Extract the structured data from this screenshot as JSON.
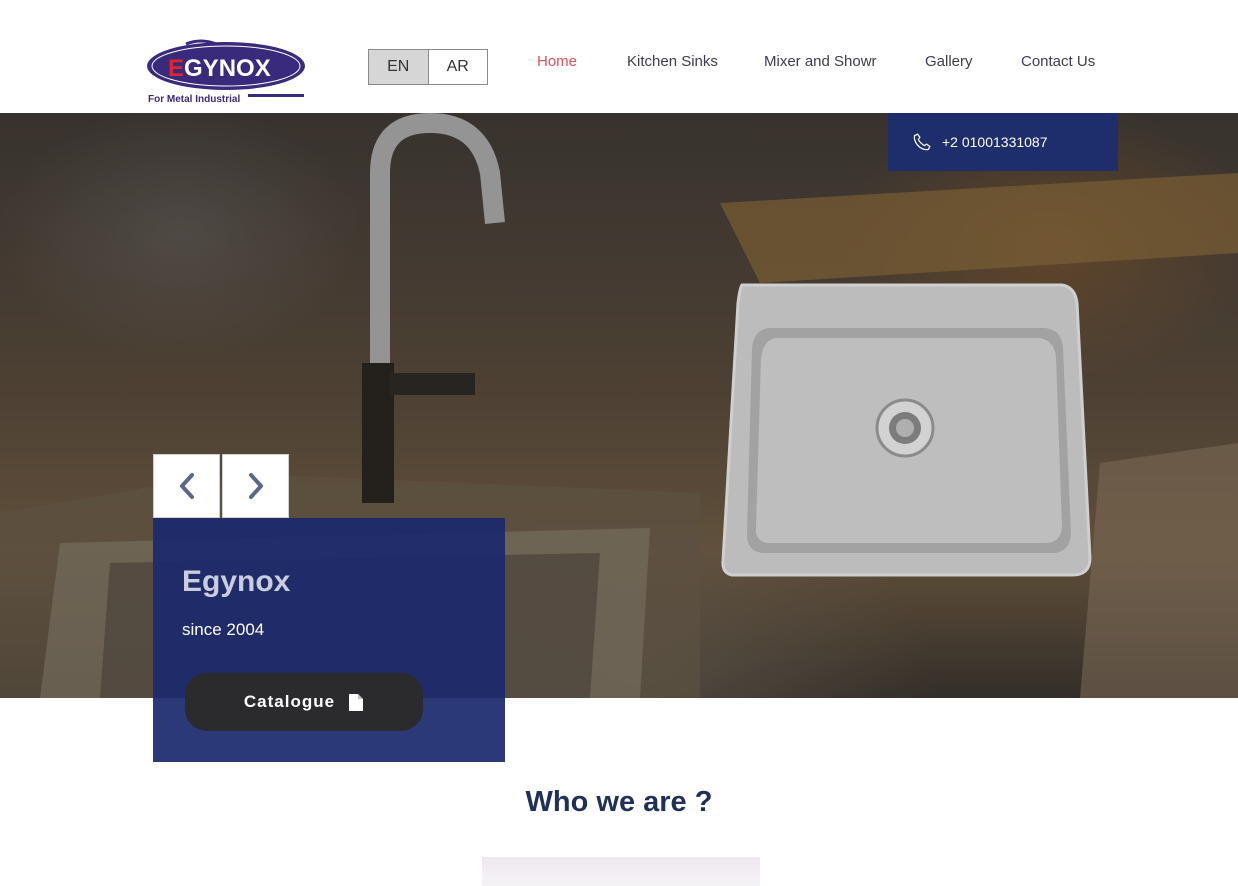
{
  "header": {
    "logo": {
      "brand": "EGYNOX",
      "tagline": "For Metal Industrial"
    },
    "language": {
      "options": [
        "EN",
        "AR"
      ],
      "selected": "EN"
    },
    "nav": [
      {
        "label": "Home",
        "active": true
      },
      {
        "label": "Kitchen Sinks",
        "active": false
      },
      {
        "label": "Mixer and Showr",
        "active": false
      },
      {
        "label": "Gallery",
        "active": false
      },
      {
        "label": "Contact Us",
        "active": false
      }
    ]
  },
  "hero": {
    "phone": "+2 01001331087",
    "title": "Egynox",
    "subtitle": "since 2004",
    "button_label": "Catalogue"
  },
  "section": {
    "title": "Who we are ?"
  },
  "colors": {
    "accent": "#e0525b",
    "brand_navy": "#1e2d6b",
    "button_dark": "#2b2b2e",
    "heading": "#1f3158"
  },
  "icons": [
    "phone-icon",
    "chevron-left-icon",
    "chevron-right-icon",
    "file-icon"
  ]
}
